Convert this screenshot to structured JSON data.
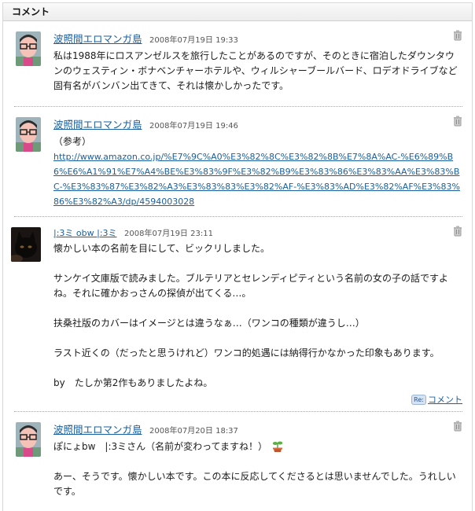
{
  "header": {
    "title": "コメント"
  },
  "comments": [
    {
      "author": "波照間エロマンガ島",
      "date": "2008年07月19日 19:33",
      "body": "私は1988年にロスアンゼルスを旅行したことがあるのですが、そのときに宿泊したダウンタウンのウェスティン・ボナベンチャーホテルや、ウィルシャーブールバード、ロデオドライブなど固有名がバンバン出てきて、それは懐かしかったです。"
    },
    {
      "author": "波照間エロマンガ島",
      "date": "2008年07月19日 19:46",
      "body": "（参考）",
      "link": "http://www.amazon.co.jp/%E7%9C%A0%E3%82%8C%E3%82%8B%E7%8A%AC-%E6%89%B6%E6%A1%91%E7%A4%BE%E3%83%9F%E3%82%B9%E3%83%86%E3%83%AA%E3%83%BC-%E3%83%87%E3%82%A3%E3%83%83%E3%82%AF-%E3%83%AD%E3%82%AF%E3%83%86%E3%82%A3/dp/4594003028"
    },
    {
      "author": "|:3ミ obw |:3ミ",
      "date": "2008年07月19日 23:11",
      "body": "懐かしい本の名前を目にして、ビックリしました。\n\nサンケイ文庫版で読みました。ブルテリアとセレンディピティという名前の女の子の話ですよね。それに確かおっさんの探偵が出てくる…。\n\n扶桑社版のカバーはイメージとは違うなぁ…（ワンコの種類が違うし…）\n\nラスト近くの（だったと思うけれど）ワンコ的処遇には納得行かなかった印象もあります。\n\nby　たしか第2作もありましたよね。",
      "reply_badge": "Re:",
      "reply_label": "コメント"
    },
    {
      "author": "波照間エロマンガ島",
      "date": "2008年07月20日 18:37",
      "body_line1": "ぽにょbw　|:3ミさん（名前が変わってますね！）",
      "body_rest": "あー、そうです。懐かしい本です。この本に反応してくださるとは思いませんでした。うれしいです。"
    }
  ],
  "icons": {
    "trash": "trash-icon",
    "avatar_person": "person-avatar",
    "avatar_cat": "black-cat-avatar",
    "sprout": "sprout-emoji-icon"
  },
  "colors": {
    "link": "#1a5fa0",
    "divider": "#a8a8a8",
    "header_bg": "#ececec"
  }
}
